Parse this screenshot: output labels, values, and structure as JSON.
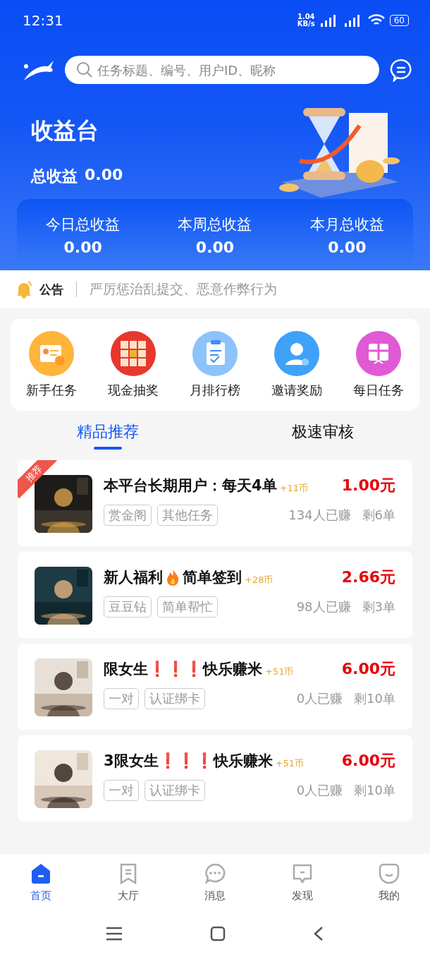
{
  "status_bar": {
    "time": "12:31",
    "speed": "1.04",
    "speed_unit": "KB/s",
    "battery": "60"
  },
  "search": {
    "placeholder": "任务标题、编号、用户ID、昵称"
  },
  "hero": {
    "title": "收益台",
    "total_label": "总收益",
    "total": "0.00",
    "stats": [
      {
        "label": "今日总收益",
        "value": "0.00"
      },
      {
        "label": "本周总收益",
        "value": "0.00"
      },
      {
        "label": "本月总收益",
        "value": "0.00"
      }
    ]
  },
  "notice": {
    "label": "公告",
    "text": "严厉惩治乱提交、恶意作弊行为"
  },
  "shortcuts": [
    {
      "label": "新手任务",
      "kind": "card"
    },
    {
      "label": "现金抽奖",
      "kind": "lottery"
    },
    {
      "label": "月排行榜",
      "kind": "clipboard"
    },
    {
      "label": "邀请奖励",
      "kind": "person"
    },
    {
      "label": "每日任务",
      "kind": "gift"
    }
  ],
  "tabs": [
    {
      "label": "精品推荐",
      "selected": true
    },
    {
      "label": "极速审核",
      "selected": false
    }
  ],
  "tasks": [
    {
      "badge": "推荐",
      "title": "本平台长期用户：每天4单",
      "coins": "+11币",
      "price": "1.00元",
      "tags": [
        "赏金阁",
        "其他任务"
      ],
      "earned": "134人已赚",
      "remaining": "剩6单"
    },
    {
      "title": "新人福利",
      "title_after": "简单签到",
      "coins": "+28币",
      "price": "2.66元",
      "tags": [
        "豆豆钻",
        "简单帮忙"
      ],
      "earned": "98人已赚",
      "remaining": "剩3单"
    },
    {
      "title": "限女生❗❗❗快乐赚米",
      "coins": "+51币",
      "price": "6.00元",
      "tags": [
        "一对",
        "认证绑卡"
      ],
      "earned": "0人已赚",
      "remaining": "剩10单"
    },
    {
      "title": "3限女生❗❗❗快乐赚米",
      "coins": "+51币",
      "price": "6.00元",
      "tags": [
        "一对",
        "认证绑卡"
      ],
      "earned": "0人已赚",
      "remaining": "剩10单"
    }
  ],
  "nav": [
    {
      "label": "首页",
      "kind": "home",
      "selected": true
    },
    {
      "label": "大厅",
      "kind": "bookmark",
      "selected": false
    },
    {
      "label": "消息",
      "kind": "chat",
      "selected": false
    },
    {
      "label": "发现",
      "kind": "discover",
      "selected": false
    },
    {
      "label": "我的",
      "kind": "face",
      "selected": false
    }
  ]
}
